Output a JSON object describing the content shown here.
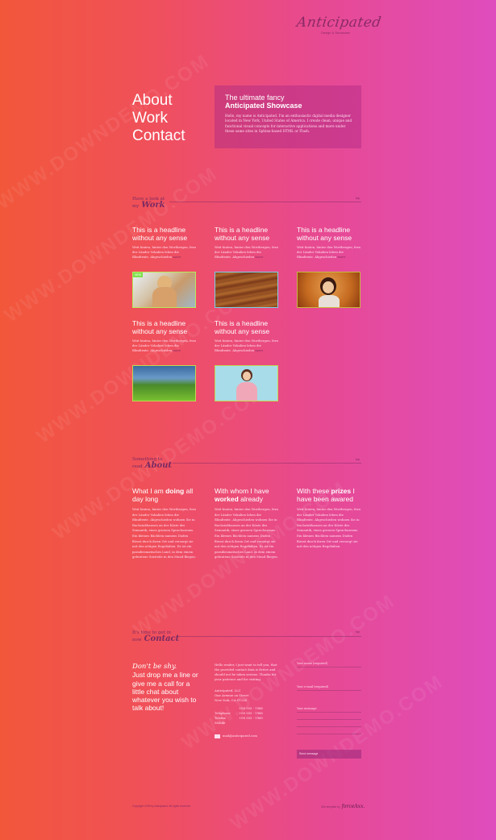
{
  "brand": {
    "logo": "Anticipated",
    "tagline": "Design & Showcase"
  },
  "nav": {
    "items": [
      "About",
      "Work",
      "Contact"
    ]
  },
  "showcase": {
    "title1": "The ultimate fancy",
    "title2": "Anticipated Showcase",
    "body": "Hello, my name is Anticipated. I'm an enthusiastic digital media designer located in New York, United States of America. I create clean, unique and functional visual concepts for interactive applications and more under these same sites in Sphinx-based HTML or Flash."
  },
  "work": {
    "head_small1": "Have a look at",
    "head_small2": "my",
    "head_big": "Work",
    "toplink": "top",
    "items": [
      {
        "title": "This is a headline without any sense",
        "text": "Weit hinten, hinter den Wortbergen, fern der Länder Vokalien leben die Blindtexte. Abgeschieden",
        "more": "more",
        "badge": "NEW"
      },
      {
        "title": "This is a headline without any sense",
        "text": "Weit hinten, hinter den Wortbergen, fern der Länder Vokalien leben die Blindtexte. Abgeschieden",
        "more": "more"
      },
      {
        "title": "This is a headline without any sense",
        "text": "Weit hinten, hinter den Wortbergen, fern der Länder Vokalien leben die Blindtexte. Abgeschieden",
        "more": "more"
      },
      {
        "title": "This is a headline without any sense",
        "text": "Weit hinten, hinter den Wortbergen, fern der Länder Vokalien leben die Blindtexte. Abgeschieden",
        "more": "more"
      },
      {
        "title": "This is a headline without any sense",
        "text": "Weit hinten, hinter den Wortbergen, fern der Länder Vokalien leben die Blindtexte. Abgeschieden",
        "more": "more"
      }
    ]
  },
  "about": {
    "head_small1": "Something to",
    "head_small2": "read",
    "head_big": "About",
    "toplink": "top",
    "cols": [
      {
        "t1": "What I am ",
        "b": "doing",
        "t2": " all day long",
        "text": "Weit hinten, hinter den Wortbergen, fern der Länder Vokalien leben die Blindtexte. Abgeschieden wohnen Sie in Buchstabhausen an der Küste des Semantik, eines grossen Sprachozeans. Ein kleines Bächlein namens Duden fliesst durch ihren Ort und versorgt sie mit den nötigen Regelialien. Es ist ein paradiesmatisches Land, in dem einem gebratene Satzteile in den Mund fliegen."
      },
      {
        "t1": "With whom I have ",
        "b": "worked",
        "t2": " already",
        "text": "Weit hinten, hinter den Wortbergen, fern der Länder Vokalien leben die Blindtexte. Abgeschieden wohnen Sie in Buchstabhausen an der Küste des Semantik, eines grossen Sprachozeans. Ein kleines Bächlein namens Duden fliesst durch ihren Ort und versorgt sie mit den nötigen Regelialien. Es ist ein paradiesmatisches Land, in dem einem gebratene Satzteile in den Mund fliegen."
      },
      {
        "t1": "With these ",
        "b": "prizes",
        "t2": " I have been awared",
        "text": "Weit hinten, hinter den Wortbergen, fern der Länder Vokalien leben die Blindtexte. Abgeschieden wohnen Sie in Buchstabhausen an der Küste des Semantik, eines grossen Sprachozeans. Ein kleines Bächlein namens Duden fliesst durch ihren Ort und versorgt sie mit den nötigen Regelialien."
      }
    ]
  },
  "contact": {
    "head_small1": "It's time to get in",
    "head_small2": "now",
    "head_big": "Contact",
    "toplink": "top",
    "lead_italic": "Don't be shy.",
    "lead": "Just drop me a line or give me a call for a little chat about whatever you wish to talk about!",
    "intro": "Hello reader, I just want to tell you, that the provided contact data is fictive and should not be taken serious. Thanks for your patience and for visiting.",
    "address": [
      "Anticipated, LLC",
      "One Avenue on Street",
      "New York, CA 01234"
    ],
    "phones": [
      {
        "label": "",
        "value": "+00 555 - 1986"
      },
      {
        "label": "Telephone",
        "value": "+00 555 - 1986"
      },
      {
        "label": "Telefax",
        "value": "+00 555 - 1960"
      },
      {
        "label": "Mobile",
        "value": ""
      }
    ],
    "email": "mail@anticipated.com",
    "form": {
      "name_label": "Your name (required)",
      "email_label": "Your e-mail (required)",
      "message_label": "Your message",
      "send_label": "Send message"
    }
  },
  "footer": {
    "copyright": "Copyright 2009 by Anticipated. All rights reserved.",
    "credit_prefix": "Site template by",
    "credit_brand": "forceAxx."
  },
  "colors": {
    "accent": "#8a2a66",
    "showcase_box": "#b52a84",
    "thumb_border": "#b9e85a"
  }
}
